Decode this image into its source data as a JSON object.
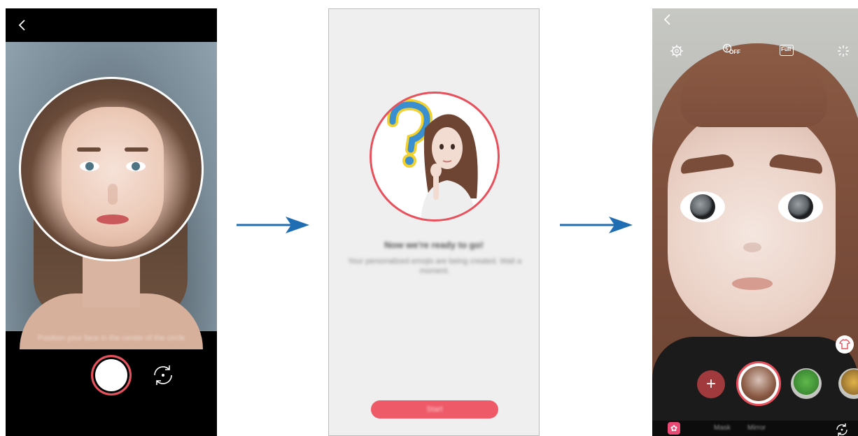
{
  "screen1": {
    "hint_text": "Position your face in the center of the circle",
    "icons": {
      "back": "back-arrow-icon",
      "flip": "switch-camera-icon"
    },
    "colors": {
      "accent": "#e8505b",
      "background": "#000000"
    }
  },
  "screen2": {
    "title": "Now we're ready to go!",
    "body": "Your personalized emojis are being created. Wait a moment.",
    "button_label": "Start",
    "colors": {
      "accent": "#ef5a68",
      "background": "#efefef"
    }
  },
  "screen3": {
    "flash_label": "OFF",
    "ratio_label": "Full",
    "plus_label": "+",
    "modes": [
      "Mask",
      "Mirror"
    ],
    "icons": {
      "back": "back-arrow-icon",
      "settings": "gear-icon",
      "flash": "flash-off-icon",
      "ratio": "full-ratio-icon",
      "effects": "sparkle-icon",
      "shirt": "shirt-icon",
      "flower": "flower-icon",
      "flip": "switch-camera-icon"
    },
    "colors": {
      "accent": "#e8505b",
      "plus_bg": "#a03a3c",
      "mode_icon": "#e84a74"
    }
  }
}
